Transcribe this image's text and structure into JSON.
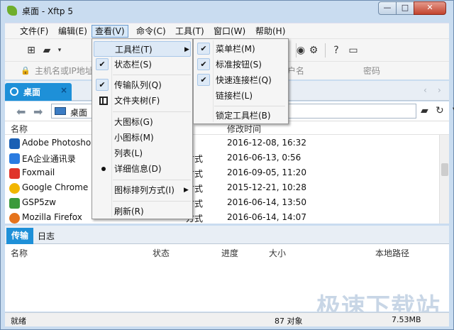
{
  "window": {
    "title": "桌面 - Xftp 5",
    "min_label": "—",
    "max_label": "□",
    "close_label": "✕"
  },
  "menubar": {
    "items": [
      {
        "label": "文件(F)"
      },
      {
        "label": "编辑(E)"
      },
      {
        "label": "查看(V)"
      },
      {
        "label": "命令(C)"
      },
      {
        "label": "工具(T)"
      },
      {
        "label": "窗口(W)"
      },
      {
        "label": "帮助(H)"
      }
    ]
  },
  "toolbar": {
    "icons": [
      "new-session-icon",
      "open-folder-icon",
      "dropdown-caret-icon",
      "xshell-icon",
      "gear-icon",
      "help-icon",
      "chat-icon"
    ]
  },
  "address": {
    "host_placeholder": "主机名或IP地址",
    "user_placeholder": "户名",
    "password_placeholder": "密码"
  },
  "tab": {
    "label": "桌面",
    "close": "×"
  },
  "path": {
    "value": "桌面"
  },
  "filelist": {
    "columns": {
      "name": "名称",
      "modified": "修改时间"
    },
    "rows": [
      {
        "name": "Adobe Photosho",
        "type": "",
        "date": "2016-12-08, 16:32",
        "color": "#1a5fb4"
      },
      {
        "name": "EA企业通讯录",
        "type": "方式",
        "date": "2016-06-13, 0:56",
        "color": "#2a7be0"
      },
      {
        "name": "Foxmail",
        "type": "方式",
        "date": "2016-09-05, 11:20",
        "color": "#e0342a"
      },
      {
        "name": "Google Chrome",
        "type": "方式",
        "date": "2015-12-21, 10:28",
        "color": "#f2b600"
      },
      {
        "name": "GSP5zw",
        "type": "方式",
        "date": "2016-06-14, 13:50",
        "color": "#3c9a3c"
      },
      {
        "name": "Mozilla Firefox",
        "type": "方式",
        "date": "2016-06-14, 14:07",
        "color": "#e5731c"
      }
    ]
  },
  "transfer": {
    "tab_transfer": "传输",
    "tab_log": "日志",
    "columns": {
      "name": "名称",
      "status": "状态",
      "progress": "进度",
      "size": "大小",
      "local_path": "本地路径"
    }
  },
  "statusbar": {
    "left": "就绪",
    "objects": "87 对象",
    "size": "7.53MB"
  },
  "watermark": "极速下载站",
  "view_menu": {
    "items": {
      "toolbar": "工具栏(T)",
      "statusbar": "状态栏(S)",
      "transfer_queue": "传输队列(Q)",
      "folder_tree": "文件夹树(F)",
      "large_icons": "大图标(G)",
      "small_icons": "小图标(M)",
      "list": "列表(L)",
      "details": "详细信息(D)",
      "arrange_icons": "图标排列方式(I)",
      "refresh": "刷新(R)"
    }
  },
  "toolbar_submenu": {
    "items": {
      "menubar": "菜单栏(M)",
      "standard_buttons": "标准按钮(S)",
      "quick_connect": "快速连接栏(Q)",
      "links": "链接栏(L)",
      "lock": "锁定工具栏(B)"
    }
  },
  "colors": {
    "accent": "#1e90d8",
    "frame": "#c9dcf0",
    "highlight": "#dde9f6"
  }
}
